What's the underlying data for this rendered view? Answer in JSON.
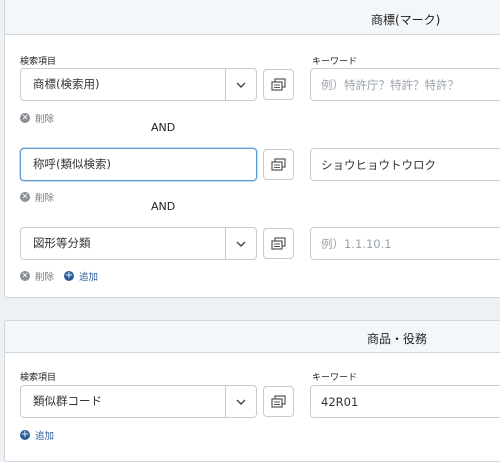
{
  "trademark_section": {
    "title": "商標(マーク)",
    "field_label": "検索項目",
    "keyword_label": "キーワード",
    "and_label": "AND",
    "delete_label": "削除",
    "add_label": "追加",
    "rows": [
      {
        "field": "商標(検索用)",
        "keyword_value": "",
        "keyword_placeholder": "例）特許庁？特許？特許？"
      },
      {
        "field": "称呼(類似検索)",
        "keyword_value": "ショウヒョウトウロク",
        "keyword_placeholder": ""
      },
      {
        "field": "図形等分類",
        "keyword_value": "",
        "keyword_placeholder": "例）1.1.10.1"
      }
    ]
  },
  "goods_section": {
    "title": "商品・役務",
    "field_label": "検索項目",
    "keyword_label": "キーワード",
    "add_label": "追加",
    "rows": [
      {
        "field": "類似群コード",
        "keyword_value": "42R01",
        "keyword_placeholder": ""
      }
    ]
  }
}
